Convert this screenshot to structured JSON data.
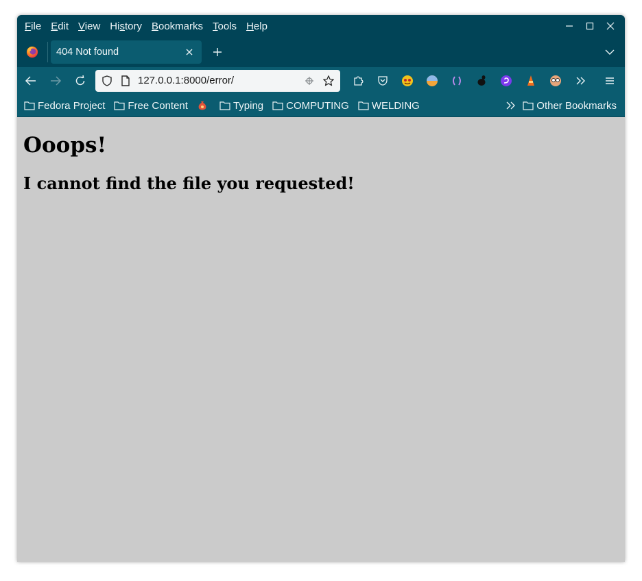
{
  "menu": {
    "items": [
      {
        "accel": "F",
        "rest": "ile"
      },
      {
        "accel": "E",
        "rest": "dit"
      },
      {
        "accel": "V",
        "rest": "iew"
      },
      {
        "pre": "Hi",
        "accel": "s",
        "rest": "tory"
      },
      {
        "accel": "B",
        "rest": "ookmarks"
      },
      {
        "accel": "T",
        "rest": "ools"
      },
      {
        "accel": "H",
        "rest": "elp"
      }
    ]
  },
  "tab": {
    "title": "404 Not found"
  },
  "urlbar": {
    "url": "127.0.0.1:8000/error/"
  },
  "bookmarks": {
    "items": [
      "Fedora Project",
      "Free Content",
      "Typing",
      "COMPUTING",
      "WELDING"
    ],
    "other": "Other Bookmarks"
  },
  "page": {
    "heading": "Ooops!",
    "subheading": "I cannot find the file you requested!"
  },
  "colors": {
    "chrome": "#014457",
    "toolbar": "#0b5c70",
    "content_bg": "#cbcbcb"
  }
}
